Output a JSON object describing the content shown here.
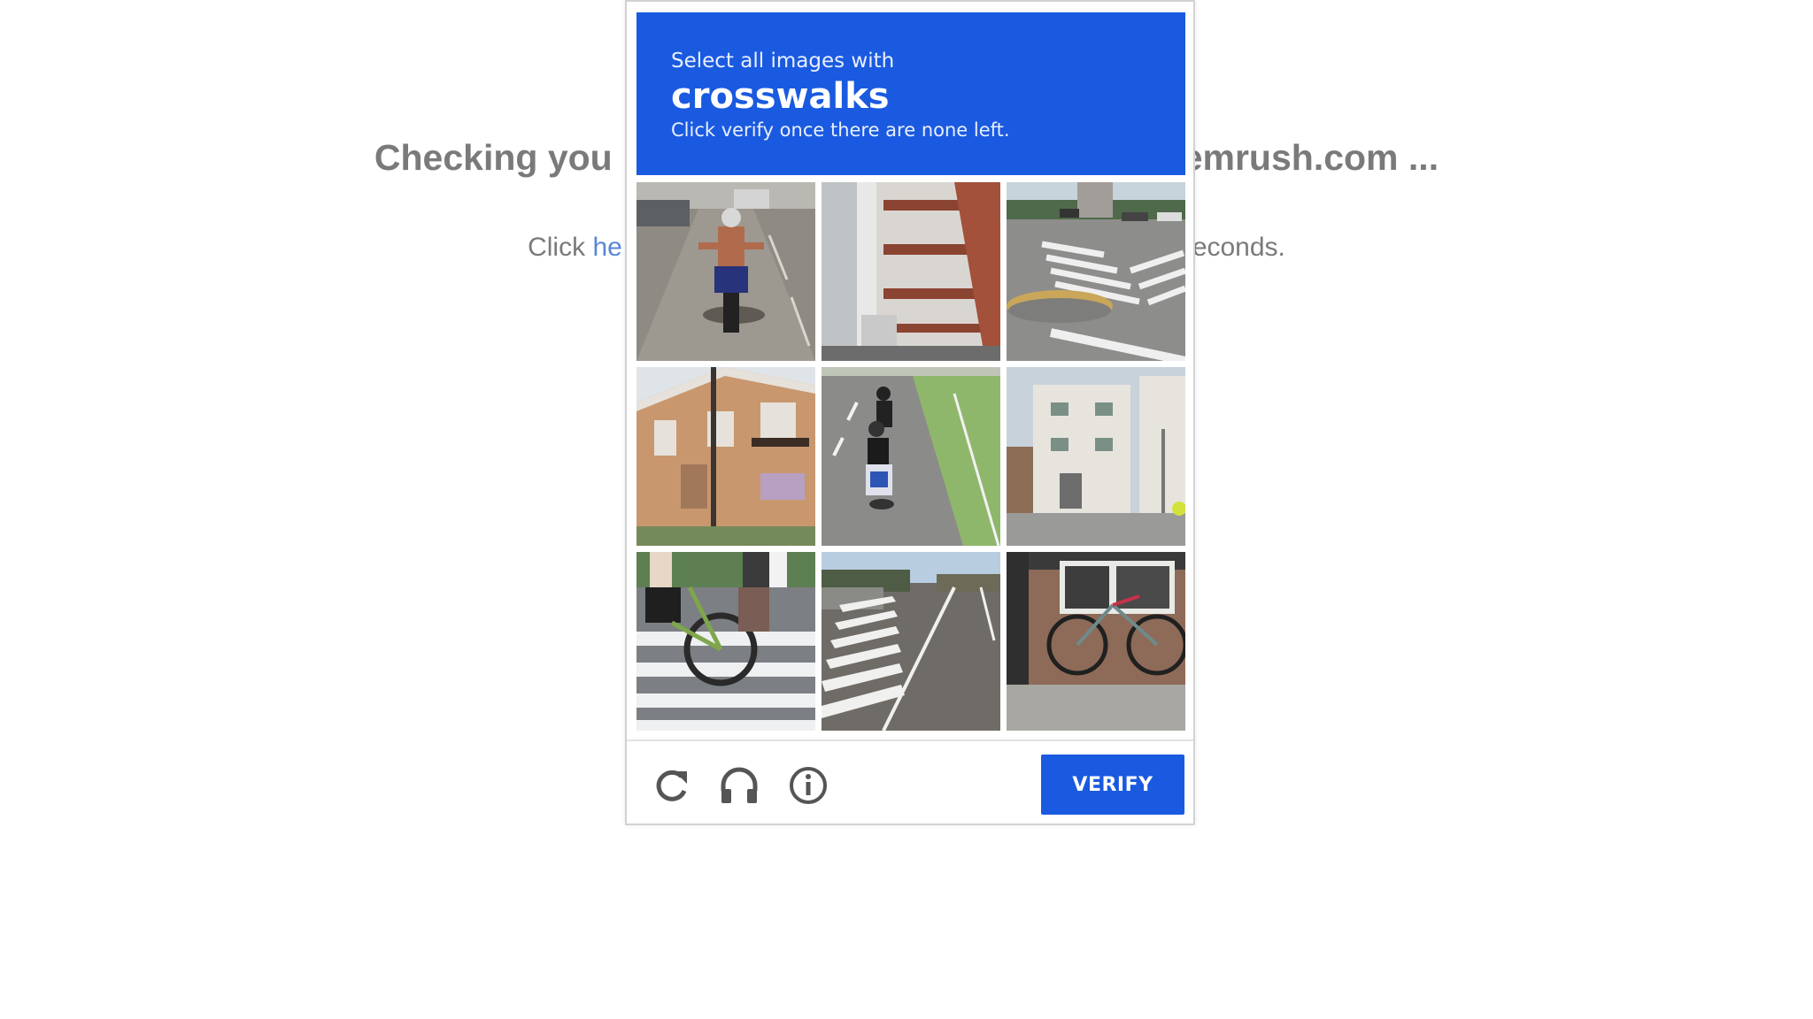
{
  "background": {
    "heading_left": "Checking you",
    "heading_right": "emrush.com ...",
    "sub_prefix": "Click ",
    "sub_link": "he",
    "sub_suffix": "econds."
  },
  "captcha": {
    "instruction": "Select all images with",
    "target": "crosswalks",
    "hint": "Click verify once there are none left.",
    "tiles": [
      {
        "subject": "motorcycle rider on road"
      },
      {
        "subject": "building railing close-up"
      },
      {
        "subject": "intersection with crosswalk"
      },
      {
        "subject": "two-story apartment building"
      },
      {
        "subject": "motorcycles on rural road"
      },
      {
        "subject": "white residential building"
      },
      {
        "subject": "bicycle on crosswalk"
      },
      {
        "subject": "road with crosswalk markings"
      },
      {
        "subject": "bicycle parked by wall"
      }
    ],
    "footer": {
      "reload_icon": "reload-icon",
      "audio_icon": "headphones-icon",
      "info_icon": "info-icon",
      "verify_label": "VERIFY"
    },
    "colors": {
      "accent": "#1a5ae0"
    }
  }
}
